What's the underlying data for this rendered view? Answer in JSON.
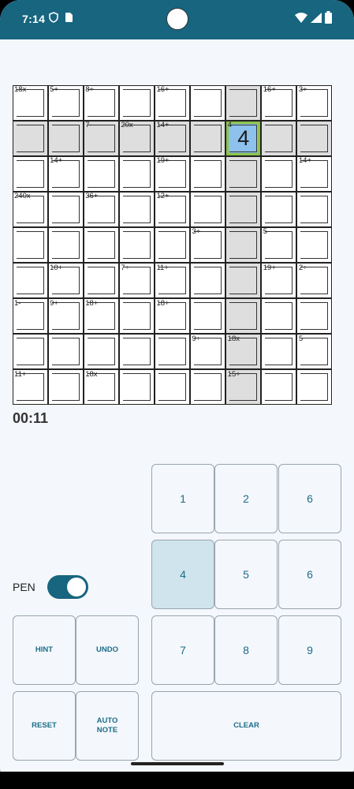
{
  "status": {
    "time": "7:14"
  },
  "grid": {
    "cells": [
      [
        "",
        "",
        "",
        "",
        "",
        "",
        "",
        "",
        ""
      ],
      [
        "",
        "",
        "",
        "",
        "",
        "",
        "4",
        "",
        ""
      ],
      [
        "",
        "",
        "",
        "",
        "",
        "",
        "",
        "",
        ""
      ],
      [
        "",
        "",
        "",
        "",
        "",
        "",
        "",
        "",
        ""
      ],
      [
        "",
        "",
        "",
        "",
        "",
        "",
        "",
        "",
        ""
      ],
      [
        "",
        "",
        "",
        "",
        "",
        "",
        "",
        "",
        ""
      ],
      [
        "",
        "",
        "",
        "",
        "",
        "",
        "",
        "",
        ""
      ],
      [
        "",
        "",
        "",
        "",
        "",
        "",
        "",
        "",
        ""
      ],
      [
        "",
        "",
        "",
        "",
        "",
        "",
        "",
        "",
        ""
      ]
    ],
    "cages": [
      {
        "label": "18x",
        "row": 0,
        "col": 0
      },
      {
        "label": "5+",
        "row": 0,
        "col": 1
      },
      {
        "label": "8÷",
        "row": 0,
        "col": 2
      },
      {
        "label": "16+",
        "row": 0,
        "col": 4
      },
      {
        "label": "16+",
        "row": 0,
        "col": 7
      },
      {
        "label": "3÷",
        "row": 0,
        "col": 8
      },
      {
        "label": "7-",
        "row": 1,
        "col": 2
      },
      {
        "label": "20x",
        "row": 1,
        "col": 3
      },
      {
        "label": "14+",
        "row": 1,
        "col": 4
      },
      {
        "label": "4",
        "row": 1,
        "col": 6
      },
      {
        "label": "14+",
        "row": 2,
        "col": 1
      },
      {
        "label": "19+",
        "row": 2,
        "col": 4
      },
      {
        "label": "14+",
        "row": 2,
        "col": 8
      },
      {
        "label": "240x",
        "row": 3,
        "col": 0
      },
      {
        "label": "36+",
        "row": 3,
        "col": 2
      },
      {
        "label": "12+",
        "row": 3,
        "col": 4
      },
      {
        "label": "3÷",
        "row": 4,
        "col": 5
      },
      {
        "label": "5-",
        "row": 4,
        "col": 7
      },
      {
        "label": "10+",
        "row": 5,
        "col": 1
      },
      {
        "label": "7÷",
        "row": 5,
        "col": 3
      },
      {
        "label": "11+",
        "row": 5,
        "col": 4
      },
      {
        "label": "19+",
        "row": 5,
        "col": 7
      },
      {
        "label": "2÷",
        "row": 5,
        "col": 8
      },
      {
        "label": "1-",
        "row": 6,
        "col": 0
      },
      {
        "label": "9+",
        "row": 6,
        "col": 1
      },
      {
        "label": "18+",
        "row": 6,
        "col": 2
      },
      {
        "label": "18+",
        "row": 6,
        "col": 4
      },
      {
        "label": "9÷",
        "row": 7,
        "col": 5
      },
      {
        "label": "18x",
        "row": 7,
        "col": 6
      },
      {
        "label": "5",
        "row": 7,
        "col": 8
      },
      {
        "label": "11+",
        "row": 8,
        "col": 0
      },
      {
        "label": "18x",
        "row": 8,
        "col": 2
      },
      {
        "label": "15+",
        "row": 8,
        "col": 6
      }
    ]
  },
  "timer": "00:11",
  "keypad": {
    "keys": [
      "1",
      "2",
      "6",
      "4",
      "5",
      "6",
      "7",
      "8",
      "9"
    ]
  },
  "controls": {
    "pen_label": "PEN",
    "hint": "HINT",
    "undo": "UNDO",
    "reset": "RESET",
    "auto_note": "AUTO\nNOTE",
    "clear": "CLEAR"
  },
  "colors": {
    "status_bar": "#17657f",
    "highlight": "#dedede",
    "selected_cell": "#8ec1ec",
    "selected_border": "#8bc34a",
    "active_key": "#cfe4ec",
    "accent_text": "#1c6d8a"
  }
}
